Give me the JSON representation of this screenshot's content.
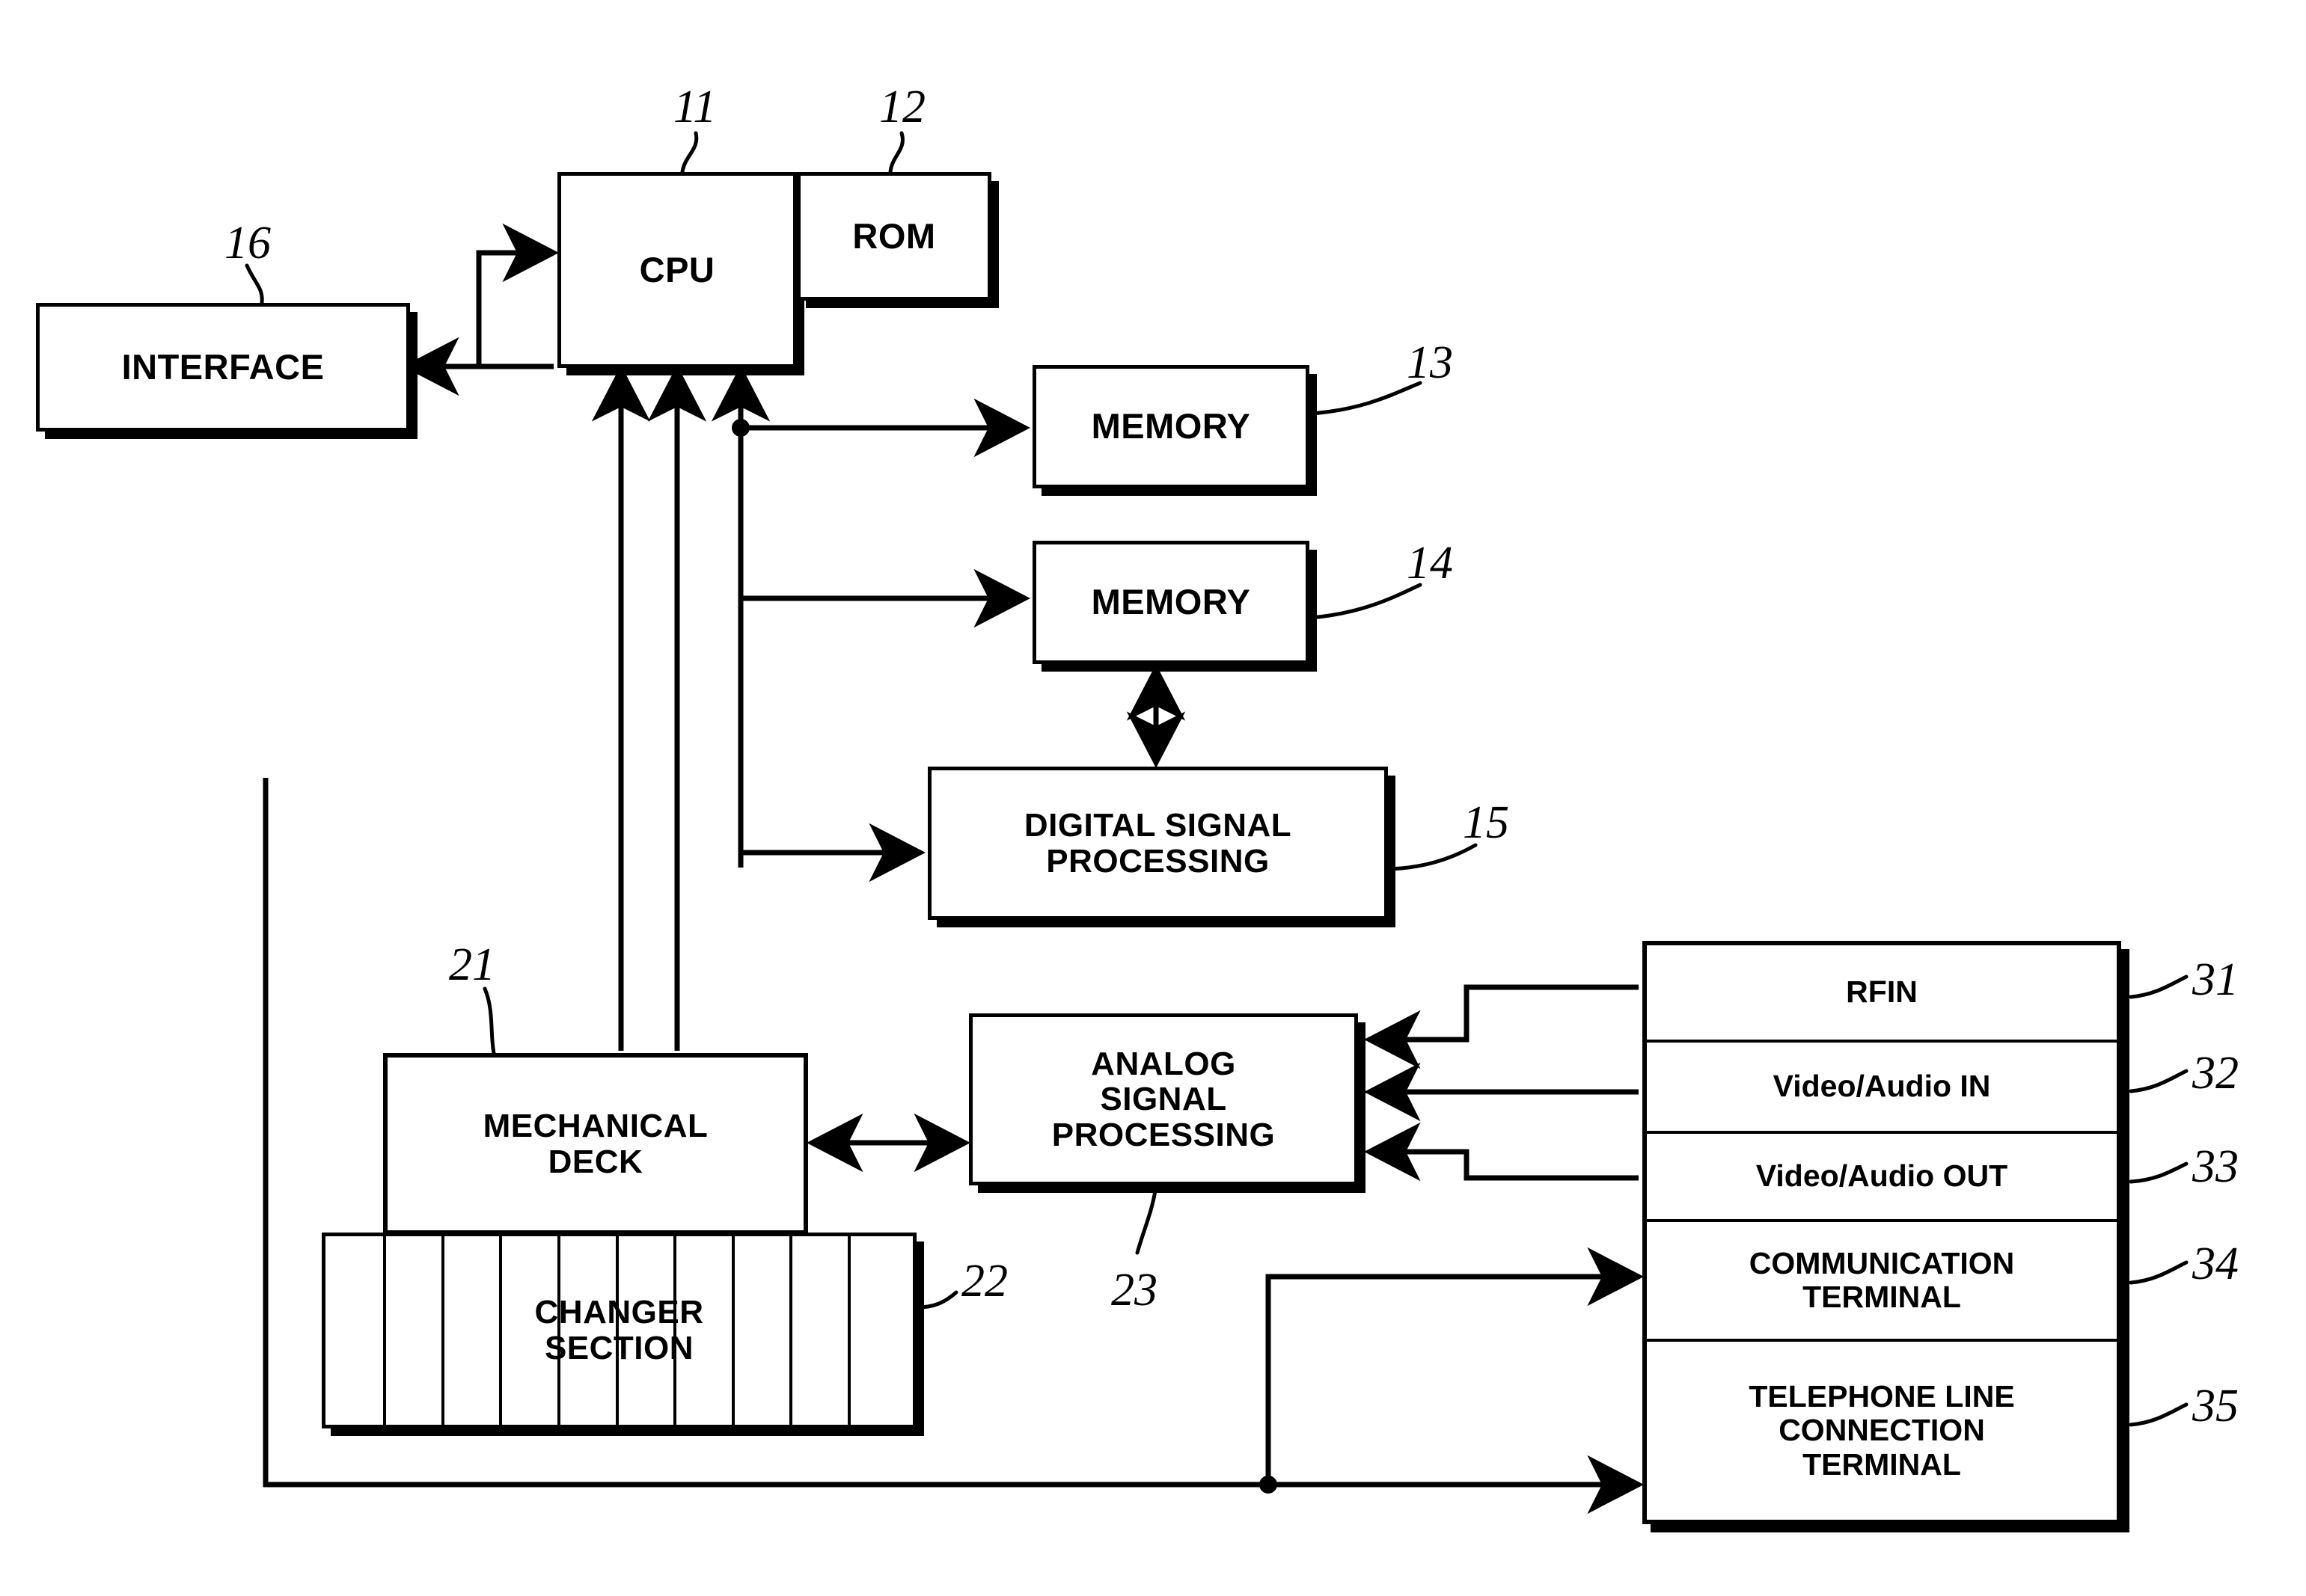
{
  "diagram": {
    "title": "Recording/Reproducing Apparatus Block Diagram",
    "background_color": "#ffffff",
    "line_color": "#000000"
  },
  "blocks": {
    "interface": {
      "label": "INTERFACE",
      "ref": "16"
    },
    "cpu": {
      "label": "CPU",
      "ref": "11"
    },
    "rom": {
      "label": "ROM",
      "ref": "12"
    },
    "memory1": {
      "label": "MEMORY",
      "ref": "13"
    },
    "memory2": {
      "label": "MEMORY",
      "ref": "14"
    },
    "dsp": {
      "label": "DIGITAL SIGNAL\nPROCESSING",
      "line1": "DIGITAL SIGNAL",
      "line2": "PROCESSING",
      "ref": "15"
    },
    "asp": {
      "line1": "ANALOG",
      "line2": "SIGNAL",
      "line3": "PROCESSING",
      "ref": "23"
    },
    "mechanical_deck": {
      "line1": "MECHANICAL",
      "line2": "DECK",
      "ref": "21"
    },
    "changer_section": {
      "line1": "CHANGER",
      "line2": "SECTION",
      "ref": "22",
      "slot_count": 9
    }
  },
  "terminal_stack": {
    "rows": [
      {
        "label": "RFIN",
        "ref": "31",
        "lines": [
          "RFIN"
        ]
      },
      {
        "label": "Video/Audio IN",
        "ref": "32",
        "lines": [
          "Video/Audio IN"
        ]
      },
      {
        "label": "Video/Audio OUT",
        "ref": "33",
        "lines": [
          "Video/Audio OUT"
        ]
      },
      {
        "label": "COMMUNICATION TERMINAL",
        "ref": "34",
        "lines": [
          "COMMUNICATION",
          "TERMINAL"
        ]
      },
      {
        "label": "TELEPHONE LINE CONNECTION TERMINAL",
        "ref": "35",
        "lines": [
          "TELEPHONE LINE",
          "CONNECTION",
          "TERMINAL"
        ]
      }
    ]
  },
  "reference_numerals": [
    "11",
    "12",
    "13",
    "14",
    "15",
    "16",
    "21",
    "22",
    "23",
    "31",
    "32",
    "33",
    "34",
    "35"
  ]
}
